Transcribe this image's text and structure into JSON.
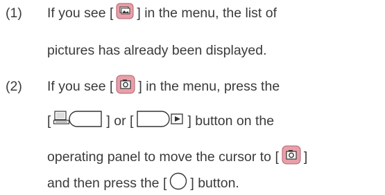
{
  "item1": {
    "number": "(1)",
    "line1_pre": "If you see [",
    "line1_post": "] in the menu, the list of",
    "line2": "pictures has already been displayed.",
    "icon": "picture-list-icon"
  },
  "item2": {
    "number": "(2)",
    "line1_pre": "If you see [",
    "line1_post": "] in the menu, press the",
    "line2_open1": "[",
    "line2_mid": "] or [",
    "line2_post": "] button on the",
    "line3_pre": "operating panel to move the cursor to [",
    "line3_post": "]",
    "line4_pre": "and then press the [",
    "line4_post": "] button.",
    "icons": [
      "camera-icon",
      "pc-left-button-icon",
      "right-play-button-icon",
      "camera-icon",
      "round-button-icon"
    ]
  }
}
